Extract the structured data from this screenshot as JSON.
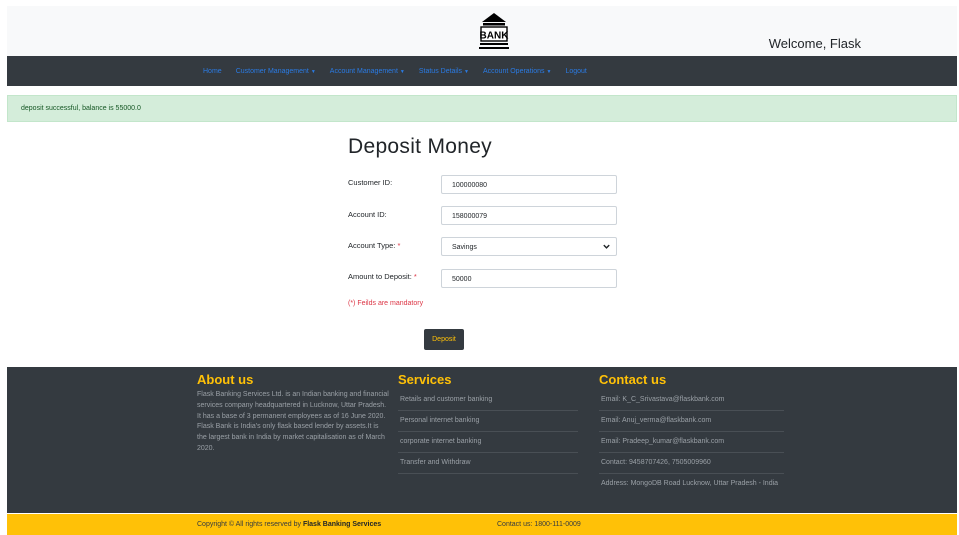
{
  "header": {
    "logo_text": "BANK",
    "welcome": "Welcome, Flask"
  },
  "nav": [
    {
      "label": "Home",
      "dropdown": false
    },
    {
      "label": "Customer Management",
      "dropdown": true
    },
    {
      "label": "Account Management",
      "dropdown": true
    },
    {
      "label": "Status Details",
      "dropdown": true
    },
    {
      "label": "Account Operations",
      "dropdown": true
    },
    {
      "label": "Logout",
      "dropdown": false
    }
  ],
  "alert": "deposit successful, balance is 55000.0",
  "form": {
    "title": "Deposit Money",
    "customer_id_label": "Customer ID:",
    "customer_id_value": "100000080",
    "account_id_label": "Account ID:",
    "account_id_value": "158000079",
    "account_type_label": "Account Type:",
    "account_type_value": "Savings",
    "amount_label": "Amount to Deposit:",
    "amount_value": "50000",
    "required_marker": "*",
    "mandatory_note": "(*) Feilds are mandatory",
    "submit_label": "Deposit"
  },
  "footer": {
    "about_heading": "About us",
    "about_text": "Flask Banking Services Ltd. is an Indian banking and financial services company headquartered in Lucknow, Uttar Pradesh. It has a base of 3 permanent employees as of 16 June 2020. Flask Bank is India's only flask based lender by assets.It is the largest bank in India by market capitalisation as of March 2020.",
    "services_heading": "Services",
    "services": [
      "Retails and customer banking",
      "Personal internet banking",
      "corporate internet banking",
      "Transfer and Withdraw"
    ],
    "contact_heading": "Contact us",
    "contacts": [
      "Email: K_C_Srivastava@flaskbank.com",
      "Email: Anuj_verma@flaskbank.com",
      "Email: Pradeep_kumar@flaskbank.com",
      "Contact: 9458707426, 7505009960",
      "Address: MongoDB Road Lucknow, Uttar Pradesh - India"
    ]
  },
  "copyright": {
    "prefix": "Copyright © All rights reserved by ",
    "brand": "Flask Banking Services",
    "contact": "Contact us: 1800-111-0009"
  },
  "colors": {
    "dark": "#343a40",
    "accent": "#ffc107",
    "link": "#2a7be4",
    "success_bg": "#d4edda",
    "required": "#dc3545"
  },
  "icons": {
    "logo": "bank-building-icon",
    "caret": "caret-down-icon",
    "select": "chevron-down-icon"
  }
}
